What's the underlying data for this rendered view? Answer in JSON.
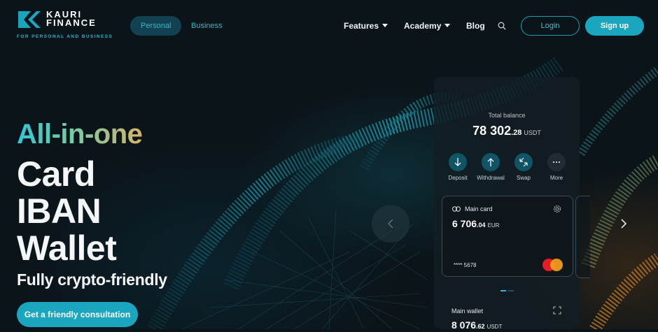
{
  "brand": {
    "name": "KAURI FINANCE",
    "name_line1": "KAURI",
    "name_line2": "FINANCE",
    "tagline": "FOR PERSONAL AND BUSINESS",
    "accent_color": "#1aa6bf"
  },
  "segments": {
    "personal": "Personal",
    "business": "Business",
    "active": "Personal"
  },
  "nav": {
    "features": "Features",
    "academy": "Academy",
    "blog": "Blog",
    "search_icon": "search-icon",
    "login": "Login",
    "signup": "Sign up"
  },
  "hero": {
    "headline_gradient": "All-in-one",
    "lines": [
      "Card",
      "IBAN",
      "Wallet"
    ],
    "subtitle": "Fully crypto-friendly",
    "cta": "Get a friendly consultation"
  },
  "app": {
    "total_balance_label": "Total balance",
    "total_balance_main": "78 302",
    "total_balance_cents": ".28",
    "total_balance_currency": "USDT",
    "actions": [
      {
        "label": "Deposit",
        "icon": "arrow-down-icon"
      },
      {
        "label": "Withdrawal",
        "icon": "arrow-up-icon"
      },
      {
        "label": "Swap",
        "icon": "swap-icon"
      },
      {
        "label": "More",
        "icon": "more-icon"
      }
    ],
    "main_card": {
      "title": "Main card",
      "balance_main": "6 706",
      "balance_cents": ".04",
      "currency": "EUR",
      "card_number": "**** 5678"
    },
    "main_wallet": {
      "title": "Main wallet",
      "balance_main": "8 076",
      "balance_cents": ".62",
      "currency": "USDT"
    }
  }
}
